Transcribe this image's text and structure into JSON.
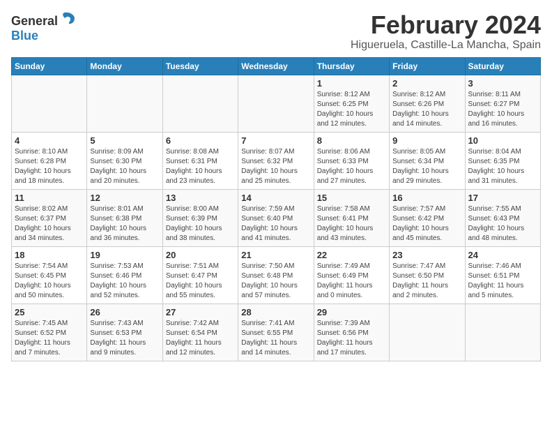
{
  "header": {
    "logo_general": "General",
    "logo_blue": "Blue",
    "month_title": "February 2024",
    "location": "Higueruela, Castille-La Mancha, Spain"
  },
  "days_of_week": [
    "Sunday",
    "Monday",
    "Tuesday",
    "Wednesday",
    "Thursday",
    "Friday",
    "Saturday"
  ],
  "weeks": [
    [
      {
        "day": "",
        "info": ""
      },
      {
        "day": "",
        "info": ""
      },
      {
        "day": "",
        "info": ""
      },
      {
        "day": "",
        "info": ""
      },
      {
        "day": "1",
        "info": "Sunrise: 8:12 AM\nSunset: 6:25 PM\nDaylight: 10 hours\nand 12 minutes."
      },
      {
        "day": "2",
        "info": "Sunrise: 8:12 AM\nSunset: 6:26 PM\nDaylight: 10 hours\nand 14 minutes."
      },
      {
        "day": "3",
        "info": "Sunrise: 8:11 AM\nSunset: 6:27 PM\nDaylight: 10 hours\nand 16 minutes."
      }
    ],
    [
      {
        "day": "4",
        "info": "Sunrise: 8:10 AM\nSunset: 6:28 PM\nDaylight: 10 hours\nand 18 minutes."
      },
      {
        "day": "5",
        "info": "Sunrise: 8:09 AM\nSunset: 6:30 PM\nDaylight: 10 hours\nand 20 minutes."
      },
      {
        "day": "6",
        "info": "Sunrise: 8:08 AM\nSunset: 6:31 PM\nDaylight: 10 hours\nand 23 minutes."
      },
      {
        "day": "7",
        "info": "Sunrise: 8:07 AM\nSunset: 6:32 PM\nDaylight: 10 hours\nand 25 minutes."
      },
      {
        "day": "8",
        "info": "Sunrise: 8:06 AM\nSunset: 6:33 PM\nDaylight: 10 hours\nand 27 minutes."
      },
      {
        "day": "9",
        "info": "Sunrise: 8:05 AM\nSunset: 6:34 PM\nDaylight: 10 hours\nand 29 minutes."
      },
      {
        "day": "10",
        "info": "Sunrise: 8:04 AM\nSunset: 6:35 PM\nDaylight: 10 hours\nand 31 minutes."
      }
    ],
    [
      {
        "day": "11",
        "info": "Sunrise: 8:02 AM\nSunset: 6:37 PM\nDaylight: 10 hours\nand 34 minutes."
      },
      {
        "day": "12",
        "info": "Sunrise: 8:01 AM\nSunset: 6:38 PM\nDaylight: 10 hours\nand 36 minutes."
      },
      {
        "day": "13",
        "info": "Sunrise: 8:00 AM\nSunset: 6:39 PM\nDaylight: 10 hours\nand 38 minutes."
      },
      {
        "day": "14",
        "info": "Sunrise: 7:59 AM\nSunset: 6:40 PM\nDaylight: 10 hours\nand 41 minutes."
      },
      {
        "day": "15",
        "info": "Sunrise: 7:58 AM\nSunset: 6:41 PM\nDaylight: 10 hours\nand 43 minutes."
      },
      {
        "day": "16",
        "info": "Sunrise: 7:57 AM\nSunset: 6:42 PM\nDaylight: 10 hours\nand 45 minutes."
      },
      {
        "day": "17",
        "info": "Sunrise: 7:55 AM\nSunset: 6:43 PM\nDaylight: 10 hours\nand 48 minutes."
      }
    ],
    [
      {
        "day": "18",
        "info": "Sunrise: 7:54 AM\nSunset: 6:45 PM\nDaylight: 10 hours\nand 50 minutes."
      },
      {
        "day": "19",
        "info": "Sunrise: 7:53 AM\nSunset: 6:46 PM\nDaylight: 10 hours\nand 52 minutes."
      },
      {
        "day": "20",
        "info": "Sunrise: 7:51 AM\nSunset: 6:47 PM\nDaylight: 10 hours\nand 55 minutes."
      },
      {
        "day": "21",
        "info": "Sunrise: 7:50 AM\nSunset: 6:48 PM\nDaylight: 10 hours\nand 57 minutes."
      },
      {
        "day": "22",
        "info": "Sunrise: 7:49 AM\nSunset: 6:49 PM\nDaylight: 11 hours\nand 0 minutes."
      },
      {
        "day": "23",
        "info": "Sunrise: 7:47 AM\nSunset: 6:50 PM\nDaylight: 11 hours\nand 2 minutes."
      },
      {
        "day": "24",
        "info": "Sunrise: 7:46 AM\nSunset: 6:51 PM\nDaylight: 11 hours\nand 5 minutes."
      }
    ],
    [
      {
        "day": "25",
        "info": "Sunrise: 7:45 AM\nSunset: 6:52 PM\nDaylight: 11 hours\nand 7 minutes."
      },
      {
        "day": "26",
        "info": "Sunrise: 7:43 AM\nSunset: 6:53 PM\nDaylight: 11 hours\nand 9 minutes."
      },
      {
        "day": "27",
        "info": "Sunrise: 7:42 AM\nSunset: 6:54 PM\nDaylight: 11 hours\nand 12 minutes."
      },
      {
        "day": "28",
        "info": "Sunrise: 7:41 AM\nSunset: 6:55 PM\nDaylight: 11 hours\nand 14 minutes."
      },
      {
        "day": "29",
        "info": "Sunrise: 7:39 AM\nSunset: 6:56 PM\nDaylight: 11 hours\nand 17 minutes."
      },
      {
        "day": "",
        "info": ""
      },
      {
        "day": "",
        "info": ""
      }
    ]
  ]
}
